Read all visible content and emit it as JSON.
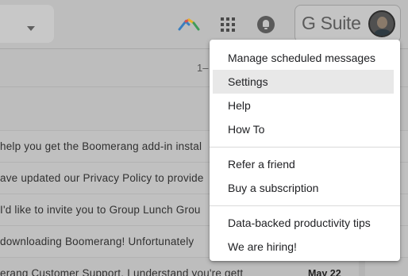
{
  "header": {
    "brand_label": "G Suite",
    "icons": [
      "search-dropdown-caret",
      "boomerang-icon",
      "apps-grid-icon",
      "notifications-icon",
      "avatar"
    ]
  },
  "toolbar": {
    "page_count": "1–"
  },
  "mail": {
    "rows": [
      {
        "snippet": "help you get the Boomerang add-in instal",
        "date": ""
      },
      {
        "snippet": "ave updated our Privacy Policy to provide",
        "date": ""
      },
      {
        "snippet": "I'd like to invite you to Group Lunch Grou",
        "date": ""
      },
      {
        "snippet": "downloading Boomerang! Unfortunately",
        "date": ""
      },
      {
        "snippet": "erang Customer Support. I understand you're gett",
        "date": "May 22"
      }
    ]
  },
  "menu": {
    "items": [
      {
        "label": "Manage scheduled messages"
      },
      {
        "label": "Settings"
      },
      {
        "label": "Help"
      },
      {
        "label": "How To"
      },
      {
        "label": "Refer a friend"
      },
      {
        "label": "Buy a subscription"
      },
      {
        "label": "Data-backed productivity tips"
      },
      {
        "label": "We are hiring!"
      }
    ],
    "highlighted": "Settings"
  },
  "colors": {
    "overlay": "#bdbdbd",
    "menu_bg": "#ffffff",
    "menu_highlight": "#e8e8e8",
    "boomerang_blue": "#3a7ebf",
    "boomerang_red": "#d9534f",
    "boomerang_yellow": "#e6b32c",
    "boomerang_green": "#3f9b5b"
  }
}
